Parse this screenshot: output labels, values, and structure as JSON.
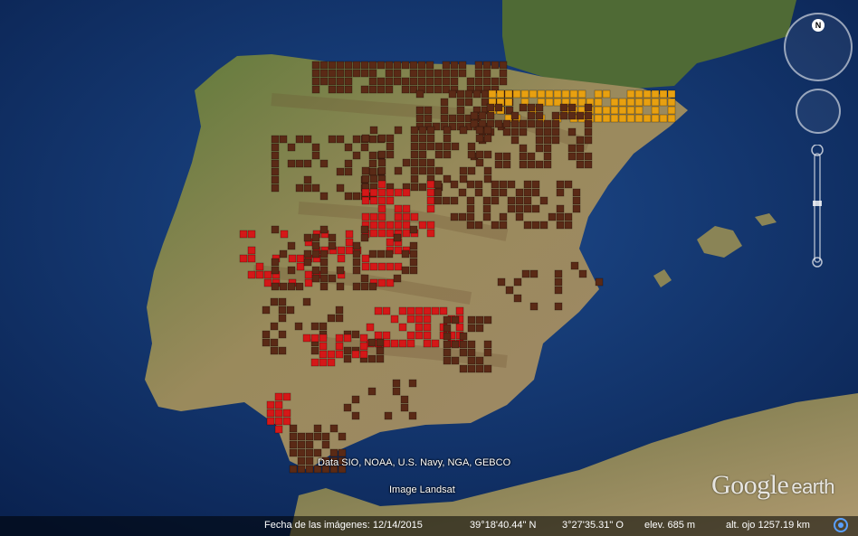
{
  "attribution": "Data SIO, NOAA, U.S. Navy, NGA, GEBCO",
  "imagery_source": "Image Landsat",
  "logo": {
    "google": "Google",
    "earth": "earth"
  },
  "navigation": {
    "north_label": "N"
  },
  "status_bar": {
    "imagery_date": "Fecha de las imágenes: 12/14/2015",
    "latitude": "39°18'40.44\" N",
    "longitude": "3°27'35.31\" O",
    "elevation": "elev.   685 m",
    "eye_altitude": "alt. ojo 1257.19 km"
  },
  "colors": {
    "ocean": "#13336b",
    "land": "#7a7a4a",
    "cell_brown": "#5a2a16",
    "cell_red": "#d41818",
    "cell_orange": "#e8a010"
  }
}
